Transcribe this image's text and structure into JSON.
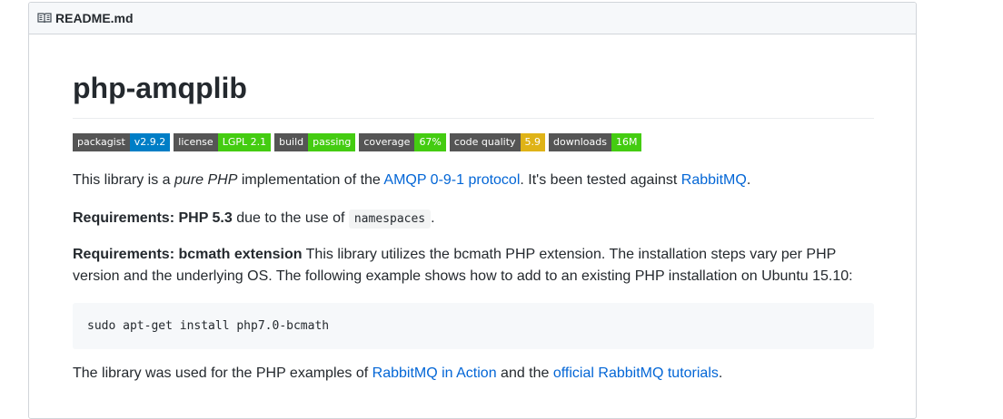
{
  "readme": {
    "filename": "README.md",
    "title": "php-amqplib",
    "badges": [
      {
        "label": "packagist",
        "value": "v2.9.2",
        "color": "#007ec6"
      },
      {
        "label": "license",
        "value": "LGPL 2.1",
        "color": "#4c1"
      },
      {
        "label": "build",
        "value": "passing",
        "color": "#4c1"
      },
      {
        "label": "coverage",
        "value": "67%",
        "color": "#4c1"
      },
      {
        "label": "code quality",
        "value": "5.9",
        "color": "#dfb317"
      },
      {
        "label": "downloads",
        "value": "16M",
        "color": "#4c1"
      }
    ],
    "p1": {
      "t1": "This library is a ",
      "em": "pure PHP",
      "t2": " implementation of the ",
      "link1": "AMQP 0-9-1 protocol",
      "t3": ". It's been tested against ",
      "link2": "RabbitMQ",
      "t4": "."
    },
    "p2": {
      "strong": "Requirements: PHP 5.3",
      "t1": " due to the use of ",
      "code": "namespaces",
      "t2": "."
    },
    "p3": {
      "strong": "Requirements: bcmath extension",
      "t1": " This library utilizes the bcmath PHP extension. The installation steps vary per PHP version and the underlying OS. The following example shows how to add to an existing PHP installation on Ubuntu 15.10:"
    },
    "code_block": "sudo apt-get install php7.0-bcmath",
    "p4": {
      "t1": "The library was used for the PHP examples of ",
      "link1": "RabbitMQ in Action",
      "t2": " and the ",
      "link2": "official RabbitMQ tutorials",
      "t3": "."
    }
  },
  "icons": {
    "readme_header": "book-icon"
  },
  "colors": {
    "link": "#0366d6",
    "text": "#24292e"
  }
}
